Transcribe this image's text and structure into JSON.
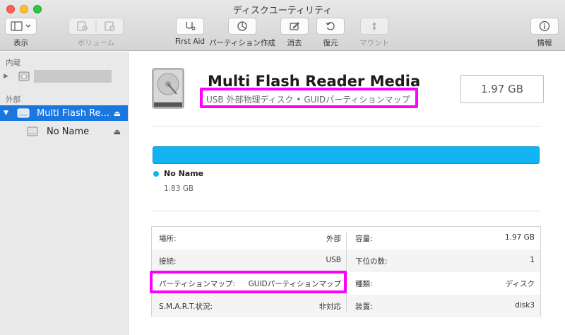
{
  "window": {
    "title": "ディスクユーティリティ"
  },
  "toolbar": {
    "view_label": "表示",
    "volume_label": "ボリューム",
    "firstaid_label": "First Aid",
    "partition_label": "パーティション作成",
    "erase_label": "消去",
    "restore_label": "復元",
    "mount_label": "マウント",
    "info_label": "情報"
  },
  "sidebar": {
    "internal_header": "内蔵",
    "external_header": "外部",
    "selected_disk": "Multi Flash Re...",
    "volume": "No Name"
  },
  "drive": {
    "name": "Multi Flash Reader Media",
    "subtitle": "USB 外部物理ディスク • GUIDパーティションマップ",
    "size": "1.97 GB"
  },
  "partition_map": {
    "volume_name": "No Name",
    "volume_size": "1.83 GB",
    "color": "#12b3f2"
  },
  "info": {
    "location_label": "場所:",
    "location_value": "外部",
    "capacity_label": "容量:",
    "capacity_value": "1.97 GB",
    "connection_label": "接続:",
    "connection_value": "USB",
    "children_label": "下位の数:",
    "children_value": "1",
    "partmap_label": "パーティションマップ:",
    "partmap_value": "GUIDパーティションマップ",
    "type_label": "種類:",
    "type_value": "ディスク",
    "smart_label": "S.M.A.R.T.状況:",
    "smart_value": "非対応",
    "device_label": "装置:",
    "device_value": "disk3"
  },
  "colors": {
    "selection": "#1b77e0",
    "highlight": "#ff00ff",
    "accent": "#12b3f2"
  }
}
